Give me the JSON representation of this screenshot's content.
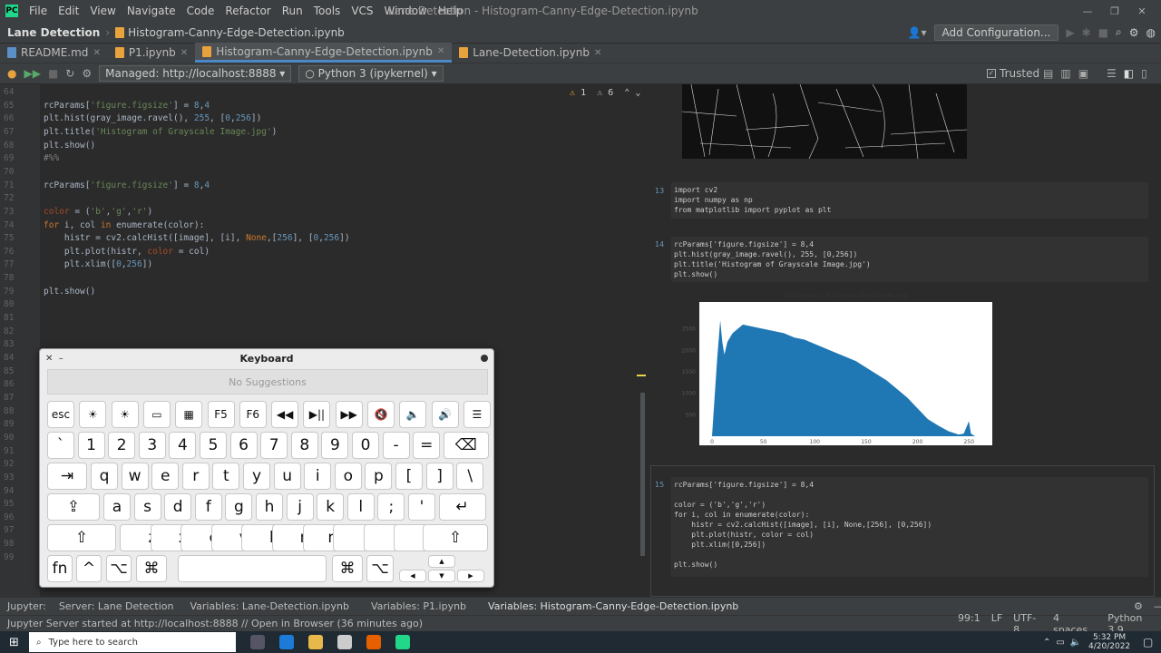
{
  "titlebar": {
    "menu": [
      "File",
      "Edit",
      "View",
      "Navigate",
      "Code",
      "Refactor",
      "Run",
      "Tools",
      "VCS",
      "Window",
      "Help"
    ],
    "title": "Lane Detection - Histogram-Canny-Edge-Detection.ipynb"
  },
  "navbar": {
    "project": "Lane Detection",
    "file": "Histogram-Canny-Edge-Detection.ipynb",
    "config": "Add Configuration..."
  },
  "tabs": [
    "README.md",
    "P1.ipynb",
    "Histogram-Canny-Edge-Detection.ipynb",
    "Lane-Detection.ipynb"
  ],
  "toolbar": {
    "server": "Managed: http://localhost:8888",
    "kernel": "Python 3 (ipykernel)",
    "trusted": "Trusted"
  },
  "inspection": {
    "warnings": "1",
    "weak": "6"
  },
  "editor": {
    "lines": [
      {
        "n": "64",
        "t": ""
      },
      {
        "n": "65",
        "t": "rcParams['figure.figsize'] = 8,4"
      },
      {
        "n": "66",
        "t": "plt.hist(gray_image.ravel(), 255, [0,256])"
      },
      {
        "n": "67",
        "t": "plt.title('Histogram of Grayscale Image.jpg')"
      },
      {
        "n": "68",
        "t": "plt.show()"
      },
      {
        "n": "69",
        "t": "#%%"
      },
      {
        "n": "70",
        "t": ""
      },
      {
        "n": "71",
        "t": "rcParams['figure.figsize'] = 8,4"
      },
      {
        "n": "72",
        "t": ""
      },
      {
        "n": "73",
        "t": "color = ('b','g','r')"
      },
      {
        "n": "74",
        "t": "for i, col in enumerate(color):"
      },
      {
        "n": "75",
        "t": "    histr = cv2.calcHist([image], [i], None,[256], [0,256])"
      },
      {
        "n": "76",
        "t": "    plt.plot(histr, color = col)"
      },
      {
        "n": "77",
        "t": "    plt.xlim([0,256])"
      },
      {
        "n": "78",
        "t": ""
      },
      {
        "n": "79",
        "t": "plt.show()"
      },
      {
        "n": "80",
        "t": ""
      },
      {
        "n": "81",
        "t": ""
      },
      {
        "n": "82",
        "t": ""
      },
      {
        "n": "83",
        "t": ""
      },
      {
        "n": "84",
        "t": ""
      },
      {
        "n": "85",
        "t": ""
      },
      {
        "n": "86",
        "t": ""
      },
      {
        "n": "87",
        "t": ""
      },
      {
        "n": "88",
        "t": ""
      },
      {
        "n": "89",
        "t": ""
      },
      {
        "n": "90",
        "t": ""
      },
      {
        "n": "91",
        "t": ""
      },
      {
        "n": "92",
        "t": ""
      },
      {
        "n": "93",
        "t": ""
      },
      {
        "n": "94",
        "t": ""
      },
      {
        "n": "95",
        "t": ""
      },
      {
        "n": "96",
        "t": ""
      },
      {
        "n": "97",
        "t": ""
      },
      {
        "n": "98",
        "t": ""
      },
      {
        "n": "99",
        "t": ""
      }
    ]
  },
  "preview": {
    "cell13": {
      "num": "13",
      "code": "import cv2\nimport numpy as np\nfrom matplotlib import pyplot as plt"
    },
    "cell14": {
      "num": "14",
      "code": "rcParams['figure.figsize'] = 8,4\nplt.hist(gray_image.ravel(), 255, [0,256])\nplt.title('Histogram of Grayscale Image.jpg')\nplt.show()"
    },
    "cell15": {
      "num": "15",
      "code": "rcParams['figure.figsize'] = 8,4\n\ncolor = ('b','g','r')\nfor i, col in enumerate(color):\n    histr = cv2.calcHist([image], [i], None,[256], [0,256])\n    plt.plot(histr, color = col)\n    plt.xlim([0,256])\n\nplt.show()"
    }
  },
  "chart_data": {
    "type": "bar",
    "title": "Histogram of Grayscale Image.jpg",
    "xlim": [
      0,
      256
    ],
    "x_ticks": [
      "0",
      "50",
      "100",
      "150",
      "200",
      "250"
    ],
    "y_ticks": [
      "500",
      "1000",
      "1500",
      "2000",
      "2500"
    ],
    "x": [
      0,
      5,
      8,
      10,
      12,
      15,
      20,
      30,
      40,
      50,
      60,
      70,
      80,
      90,
      100,
      110,
      120,
      130,
      140,
      150,
      160,
      170,
      180,
      190,
      200,
      210,
      220,
      230,
      240,
      245,
      250,
      252,
      256
    ],
    "values": [
      0,
      1800,
      2700,
      2200,
      1900,
      2200,
      2400,
      2600,
      2550,
      2500,
      2450,
      2400,
      2300,
      2250,
      2150,
      2050,
      1950,
      1850,
      1750,
      1600,
      1450,
      1300,
      1100,
      900,
      650,
      400,
      250,
      120,
      40,
      60,
      350,
      60,
      0
    ],
    "color": "#1f77b4"
  },
  "keyboard": {
    "title": "Keyboard",
    "suggestions": "No Suggestions",
    "row1": [
      "esc",
      "☀",
      "☀",
      "▭",
      "▦",
      "F5",
      "F6",
      "◀◀",
      "▶||",
      "▶▶",
      "🔇",
      "🔈",
      "🔊",
      "☰"
    ],
    "row2": [
      "`",
      "1",
      "2",
      "3",
      "4",
      "5",
      "6",
      "7",
      "8",
      "9",
      "0",
      "-",
      "=",
      "⌫"
    ],
    "row2s": [
      "~",
      "!",
      "@",
      "#",
      "$",
      "%",
      "^",
      "&",
      "*",
      "(",
      ")",
      "_",
      "+",
      ""
    ],
    "row3": [
      "⇥",
      "q",
      "w",
      "e",
      "r",
      "t",
      "y",
      "u",
      "i",
      "o",
      "p",
      "[",
      "]",
      "\\"
    ],
    "row4": [
      "⇪",
      "a",
      "s",
      "d",
      "f",
      "g",
      "h",
      "j",
      "k",
      "l",
      ";",
      "'",
      "↵"
    ],
    "row5": [
      "⇧",
      "z",
      "x",
      "c",
      "v",
      "b",
      "n",
      "m",
      ",",
      ".",
      "/",
      "⇧"
    ],
    "row6": [
      "fn",
      "^",
      "⌥",
      "⌘",
      "",
      "⌘",
      "⌥"
    ]
  },
  "bottom": {
    "tabs": [
      "Jupyter:",
      "Server: Lane Detection",
      "Variables: Lane-Detection.ipynb",
      "Variables: P1.ipynb",
      "Variables: Histogram-Canny-Edge-Detection.ipynb"
    ]
  },
  "status": {
    "msg": "Jupyter Server started at http://localhost:8888 // Open in Browser (36 minutes ago)",
    "pos": "99:1",
    "lf": "LF",
    "enc": "UTF-8",
    "indent": "4 spaces",
    "py": "Python 3.9"
  },
  "taskbar": {
    "search": "Type here to search",
    "time": "5:32 PM",
    "date": "4/20/2022"
  }
}
